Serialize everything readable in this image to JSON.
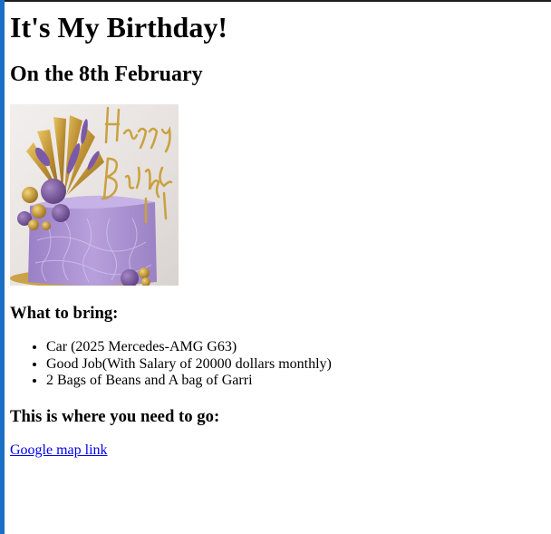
{
  "page": {
    "title": "It's My Birthday!",
    "subtitle": "On the 8th February",
    "image_icon": "birthday-cake-image",
    "bring_heading": "What to bring:",
    "bring_items": [
      "Car (2025 Mercedes-AMG G63)",
      "Good Job(With Salary of 20000 dollars monthly)",
      "2 Bags of Beans and A bag of Garri"
    ],
    "go_heading": "This is where you need to go:",
    "map_link_label": "Google map link"
  },
  "colors": {
    "link": "#0000ee",
    "left_bar": "#1a6fc4",
    "cake_frosting": "#a88fd0",
    "topper_gold": "#c8a23c"
  }
}
